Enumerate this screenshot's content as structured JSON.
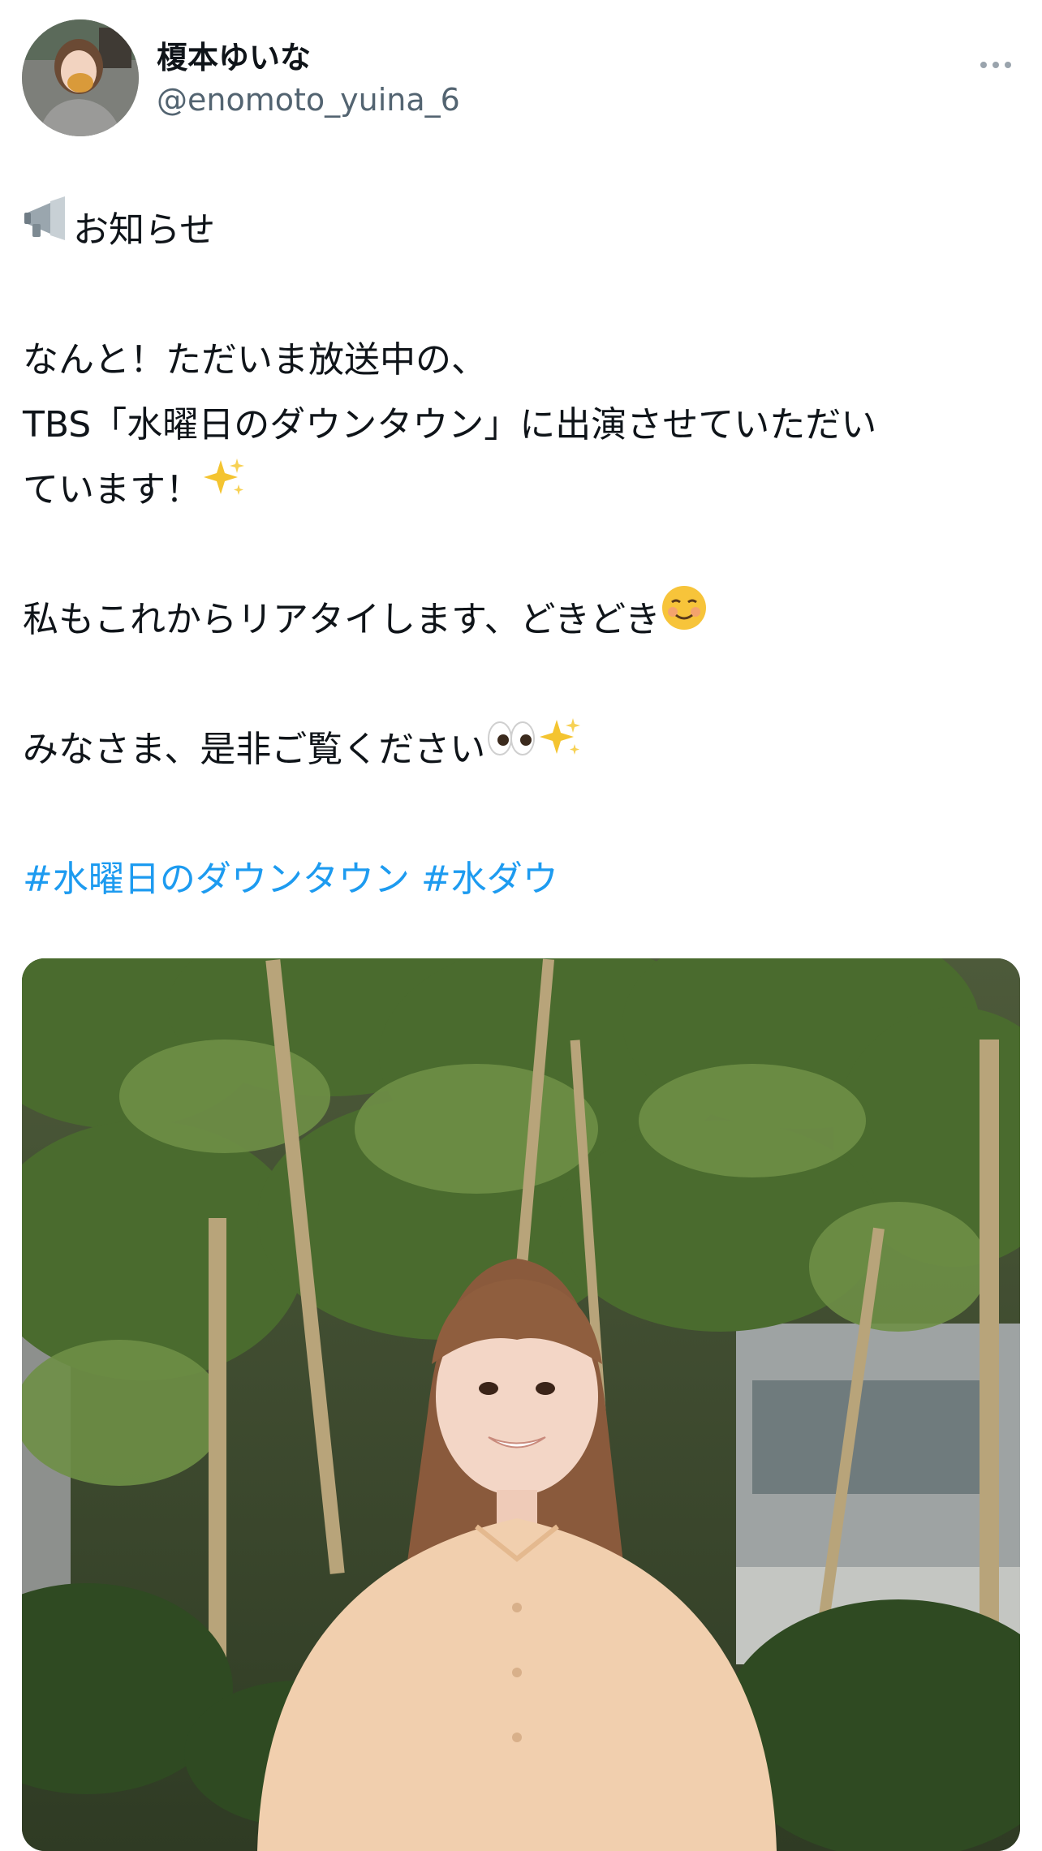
{
  "author": {
    "display_name": "榎本ゆいな",
    "handle": "@enomoto_yuina_6",
    "avatar_icon": "profile-photo-icon"
  },
  "tweet": {
    "lines": {
      "announce": "お知らせ",
      "line2": "なんと！ただいま放送中の、",
      "line3": "TBS「水曜日のダウンタウン」に出演させていただい",
      "line4": "ています！",
      "line5": "私もこれからリアタイします、どきどき",
      "line6": "みなさま、是非ご覧ください"
    },
    "hashtags": [
      "#水曜日のダウンタウン",
      "#水ダウ"
    ],
    "emojis": {
      "megaphone": "megaphone-icon",
      "sparkles": "sparkles-icon",
      "smile": "smiling-face-icon",
      "eyes": "eyes-icon"
    }
  },
  "colors": {
    "text": "#0f1419",
    "secondary": "#536471",
    "link": "#1d9bf0"
  },
  "media": {
    "icon": "photo-icon"
  }
}
